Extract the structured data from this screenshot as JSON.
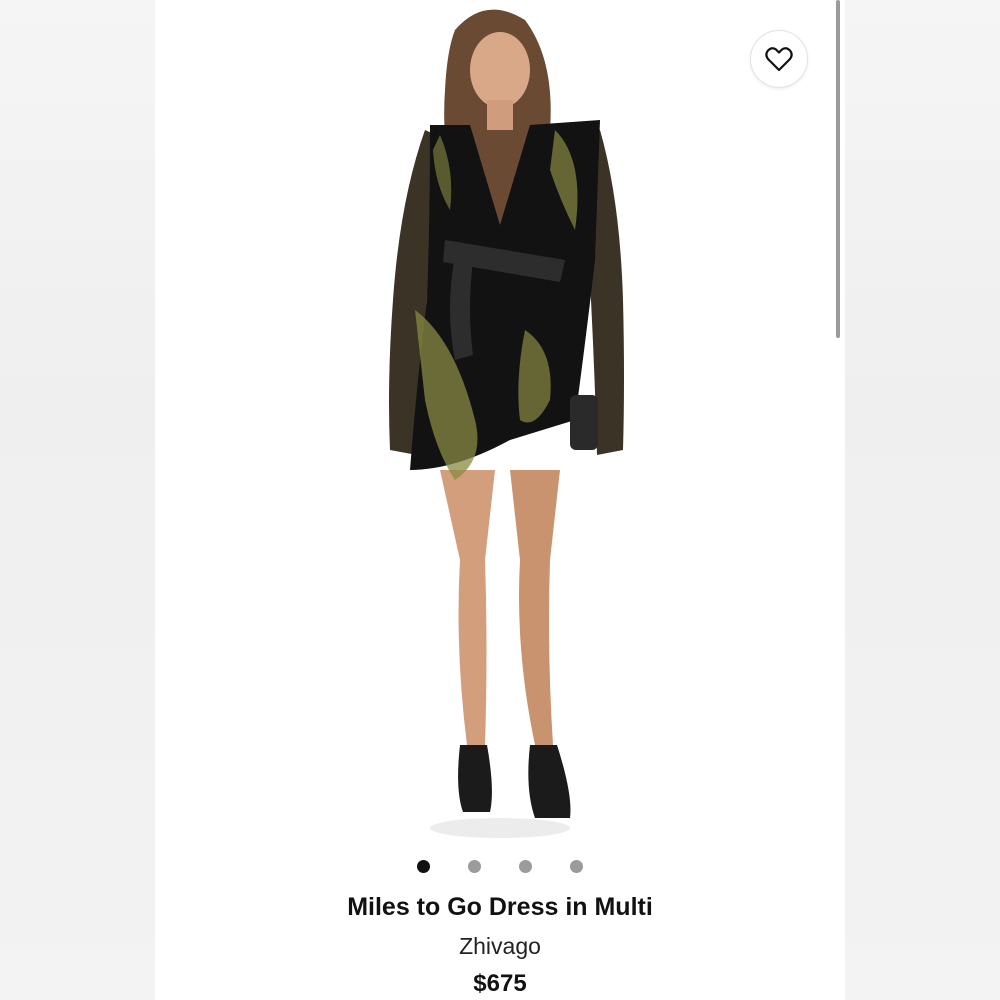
{
  "product": {
    "title": "Miles to Go Dress in Multi",
    "brand": "Zhivago",
    "price": "$675",
    "image_alt": "model wearing black embellished long-sleeve mini dress",
    "carousel": {
      "total": 4,
      "active_index": 0
    }
  },
  "icons": {
    "favorite": "heart-outline-icon"
  },
  "colors": {
    "dot_active": "#111111",
    "dot_inactive": "#9b9b9b",
    "background": "#ffffff"
  }
}
